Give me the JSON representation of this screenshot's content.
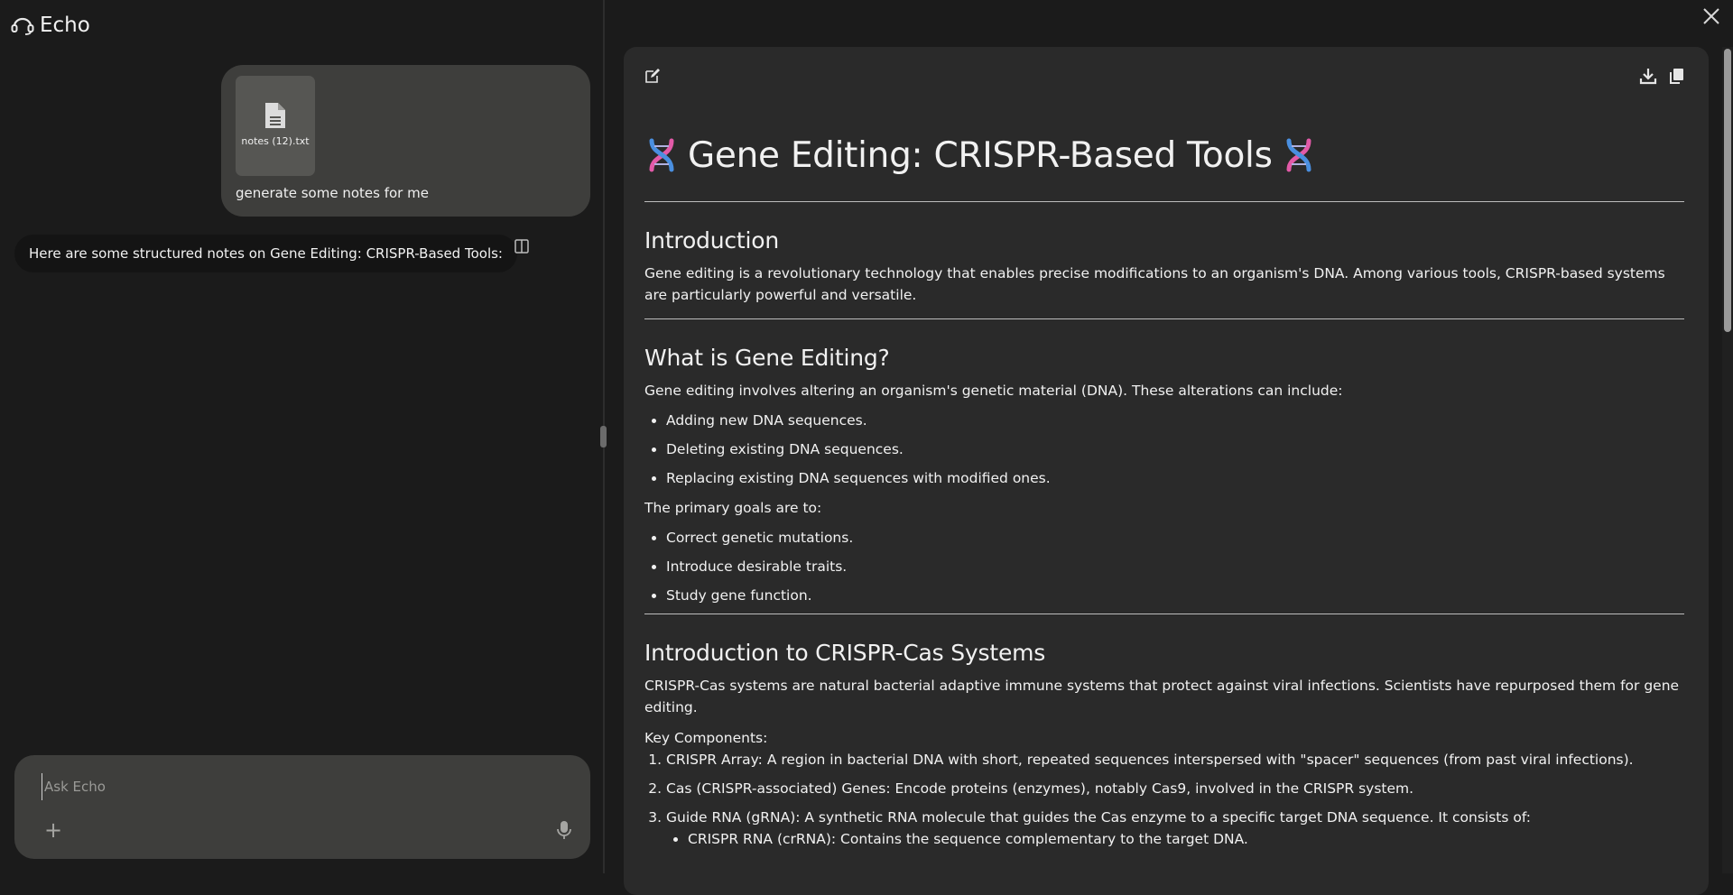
{
  "app": {
    "title": "Echo",
    "logo_icon": "headset-logo-icon"
  },
  "chat": {
    "user_message": {
      "attachment": {
        "name": "notes (12).txt",
        "icon": "file-text-icon"
      },
      "text": "generate some notes for me"
    },
    "assistant_message": {
      "text": "Here are some structured notes on Gene Editing: CRISPR-Based Tools:"
    }
  },
  "composer": {
    "placeholder": "Ask Echo",
    "value": "",
    "add_label": "+"
  },
  "document": {
    "title": "Gene Editing: CRISPR-Based Tools",
    "sections": {
      "intro": {
        "heading": "Introduction",
        "paragraph": "Gene editing is a revolutionary technology that enables precise modifications to an organism's DNA. Among various tools, CRISPR-based systems are particularly powerful and versatile."
      },
      "what": {
        "heading": "What is Gene Editing?",
        "paragraph": "Gene editing involves altering an organism's genetic material (DNA). These alterations can include:",
        "items": [
          "Adding new DNA sequences.",
          "Deleting existing DNA sequences.",
          "Replacing existing DNA sequences with modified ones."
        ],
        "goals_intro": "The primary goals are to:",
        "goals": [
          "Correct genetic mutations.",
          "Introduce desirable traits.",
          "Study gene function."
        ]
      },
      "crispr": {
        "heading": "Introduction to CRISPR-Cas Systems",
        "paragraph": "CRISPR-Cas systems are natural bacterial adaptive immune systems that protect against viral infections. Scientists have repurposed them for gene editing.",
        "components_label": "Key Components:",
        "components": [
          "CRISPR Array: A region in bacterial DNA with short, repeated sequences interspersed with \"spacer\" sequences (from past viral infections).",
          "Cas (CRISPR-associated) Genes: Encode proteins (enzymes), notably Cas9, involved in the CRISPR system.",
          "Guide RNA (gRNA): A synthetic RNA molecule that guides the Cas enzyme to a specific target DNA sequence. It consists of:"
        ],
        "subcomponents": [
          "CRISPR RNA (crRNA): Contains the sequence complementary to the target DNA."
        ]
      }
    }
  },
  "icons": {
    "title_decor": "dna-icon",
    "edit": "edit-icon",
    "download": "download-icon",
    "copy": "copy-icon",
    "close": "close-icon",
    "mic": "microphone-icon",
    "panel": "panel-toggle-icon"
  },
  "colors": {
    "background": "#1b1b1b",
    "bubble": "#3e3e3c",
    "doc_panel": "#2a2a2a",
    "dna_pink": "#e25aa8",
    "dna_blue": "#4a8fe0"
  }
}
